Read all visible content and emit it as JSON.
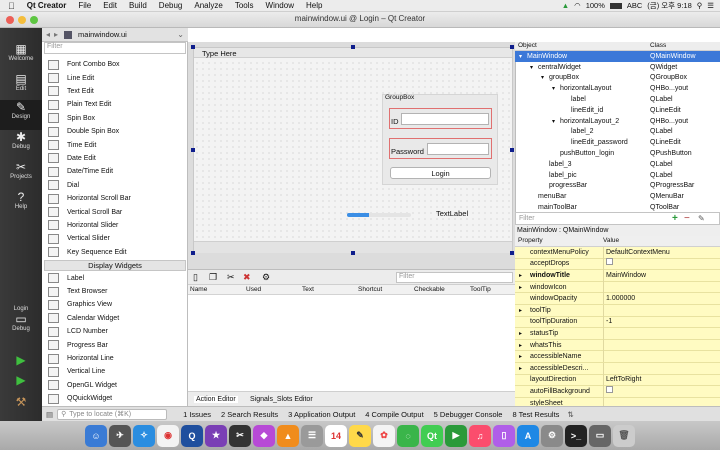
{
  "menubar": {
    "app": "Qt Creator",
    "items": [
      "File",
      "Edit",
      "Build",
      "Debug",
      "Analyze",
      "Tools",
      "Window",
      "Help"
    ],
    "battery": "100%",
    "input_source": "ABC",
    "clock": "(금) 오후 9:18"
  },
  "window": {
    "title": "mainwindow.ui @ Login – Qt Creator"
  },
  "modes": [
    "Welcome",
    "Edit",
    "Design",
    "Debug",
    "Projects",
    "Help"
  ],
  "kit": {
    "name": "Login",
    "sub": "Debug"
  },
  "tab": {
    "label": "mainwindow.ui"
  },
  "widget_box": {
    "filter_placeholder": "Filter",
    "items_a": [
      "Font Combo Box",
      "Line Edit",
      "Text Edit",
      "Plain Text Edit",
      "Spin Box",
      "Double Spin Box",
      "Time Edit",
      "Date Edit",
      "Date/Time Edit",
      "Dial",
      "Horizontal Scroll Bar",
      "Vertical Scroll Bar",
      "Horizontal Slider",
      "Vertical Slider",
      "Key Sequence Edit"
    ],
    "category": "Display Widgets",
    "items_b": [
      "Label",
      "Text Browser",
      "Graphics View",
      "Calendar Widget",
      "LCD Number",
      "Progress Bar",
      "Horizontal Line",
      "Vertical Line",
      "OpenGL Widget",
      "QQuickWidget"
    ]
  },
  "form": {
    "menu_placeholder": "Type Here",
    "groupbox_title": "GroupBox",
    "id_label": "ID",
    "password_label": "Password",
    "login_button": "Login",
    "text_label": "TextLabel",
    "progress": 0.35
  },
  "object_inspector": {
    "headers": [
      "Object",
      "Class"
    ],
    "rows": [
      {
        "name": "MainWindow",
        "cls": "QMainWindow",
        "indent": 0,
        "arrow": "▾",
        "sel": true
      },
      {
        "name": "centralWidget",
        "cls": "QWidget",
        "indent": 1,
        "arrow": "▾"
      },
      {
        "name": "groupBox",
        "cls": "QGroupBox",
        "indent": 2,
        "arrow": "▾"
      },
      {
        "name": "horizontalLayout",
        "cls": "QHBo...yout",
        "indent": 3,
        "arrow": "▾"
      },
      {
        "name": "label",
        "cls": "QLabel",
        "indent": 4,
        "arrow": ""
      },
      {
        "name": "lineEdit_id",
        "cls": "QLineEdit",
        "indent": 4,
        "arrow": ""
      },
      {
        "name": "horizontalLayout_2",
        "cls": "QHBo...yout",
        "indent": 3,
        "arrow": "▾"
      },
      {
        "name": "label_2",
        "cls": "QLabel",
        "indent": 4,
        "arrow": ""
      },
      {
        "name": "lineEdit_password",
        "cls": "QLineEdit",
        "indent": 4,
        "arrow": ""
      },
      {
        "name": "pushButton_login",
        "cls": "QPushButton",
        "indent": 3,
        "arrow": ""
      },
      {
        "name": "label_3",
        "cls": "QLabel",
        "indent": 2,
        "arrow": ""
      },
      {
        "name": "label_pic",
        "cls": "QLabel",
        "indent": 2,
        "arrow": ""
      },
      {
        "name": "progressBar",
        "cls": "QProgressBar",
        "indent": 2,
        "arrow": ""
      },
      {
        "name": "menuBar",
        "cls": "QMenuBar",
        "indent": 1,
        "arrow": ""
      },
      {
        "name": "mainToolBar",
        "cls": "QToolBar",
        "indent": 1,
        "arrow": ""
      }
    ]
  },
  "property_editor": {
    "filter_placeholder": "Filter",
    "title": "MainWindow : QMainWindow",
    "headers": [
      "Property",
      "Value"
    ],
    "rows": [
      {
        "name": "contextMenuPolicy",
        "value": "DefaultContextMenu",
        "arrow": ""
      },
      {
        "name": "acceptDrops",
        "value": "",
        "check": true,
        "arrow": ""
      },
      {
        "name": "windowTitle",
        "value": "MainWindow",
        "arrow": "▸",
        "bold": true
      },
      {
        "name": "windowIcon",
        "value": "",
        "arrow": "▸"
      },
      {
        "name": "windowOpacity",
        "value": "1.000000",
        "arrow": ""
      },
      {
        "name": "toolTip",
        "value": "",
        "arrow": "▸"
      },
      {
        "name": "toolTipDuration",
        "value": "-1",
        "arrow": ""
      },
      {
        "name": "statusTip",
        "value": "",
        "arrow": "▸"
      },
      {
        "name": "whatsThis",
        "value": "",
        "arrow": "▸"
      },
      {
        "name": "accessibleName",
        "value": "",
        "arrow": "▸"
      },
      {
        "name": "accessibleDescri...",
        "value": "",
        "arrow": "▸"
      },
      {
        "name": "layoutDirection",
        "value": "LeftToRight",
        "arrow": ""
      },
      {
        "name": "autoFillBackground",
        "value": "",
        "check": true,
        "arrow": ""
      },
      {
        "name": "styleSheet",
        "value": "",
        "arrow": ""
      }
    ]
  },
  "action_editor": {
    "filter_placeholder": "Filter",
    "headers": [
      "Name",
      "Used",
      "Text",
      "Shortcut",
      "Checkable",
      "ToolTip"
    ],
    "tabs": [
      "Action Editor",
      "Signals_Slots Editor"
    ]
  },
  "locator": {
    "placeholder": "Type to locate (⌘K)"
  },
  "output_panes": [
    "1  Issues",
    "2  Search Results",
    "3  Application Output",
    "4  Compile Output",
    "5  Debugger Console",
    "8  Test Results"
  ],
  "colors": {
    "accent": "#3b8ee5",
    "selection": "#3b78d8",
    "property_row": "#fffbc2"
  }
}
